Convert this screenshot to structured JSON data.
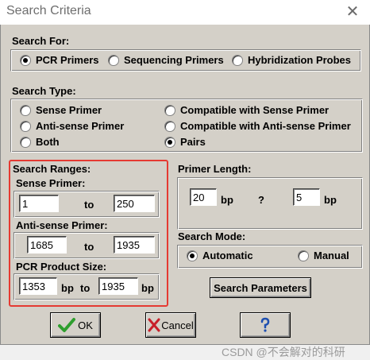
{
  "window": {
    "title": "Search Criteria",
    "close_glyph": "✕"
  },
  "search_for": {
    "label": "Search For:",
    "options": [
      {
        "label": "PCR Primers",
        "selected": true
      },
      {
        "label": "Sequencing Primers",
        "selected": false
      },
      {
        "label": "Hybridization Probes",
        "selected": false
      }
    ]
  },
  "search_type": {
    "label": "Search Type:",
    "options": [
      {
        "label": "Sense Primer",
        "selected": false
      },
      {
        "label": "Compatible with Sense Primer",
        "selected": false
      },
      {
        "label": "Anti-sense Primer",
        "selected": false
      },
      {
        "label": "Compatible with Anti-sense Primer",
        "selected": false
      },
      {
        "label": "Both",
        "selected": false
      },
      {
        "label": "Pairs",
        "selected": true
      }
    ]
  },
  "search_ranges": {
    "label": "Search Ranges:",
    "sense": {
      "label": "Sense Primer:",
      "from": "1",
      "to_label": "to",
      "to": "250"
    },
    "antisense": {
      "label": "Anti-sense Primer:",
      "from": "1685",
      "to_label": "to",
      "to": "1935"
    },
    "product": {
      "label": "PCR Product Size:",
      "from": "1353",
      "unit": "bp",
      "to_label": "to",
      "to": "1935",
      "unit2": "bp"
    }
  },
  "primer_length": {
    "label": "Primer Length:",
    "min": "20",
    "unit": "bp",
    "mid": "?",
    "max": "5",
    "unit2": "bp"
  },
  "search_mode": {
    "label": "Search Mode:",
    "options": [
      {
        "label": "Automatic",
        "selected": true
      },
      {
        "label": "Manual",
        "selected": false
      }
    ]
  },
  "buttons": {
    "params": "Search Parameters",
    "ok": "OK",
    "cancel": "Cancel"
  },
  "icons": {
    "ok": "check-icon",
    "cancel": "x-icon",
    "help": "help-icon"
  },
  "watermark": "CSDN @不会解对的科研",
  "colors": {
    "highlight_box": "#e53a32",
    "dialog_bg": "#d4d0c8",
    "check": "#2e9e2e",
    "cancel_x": "#c8202a"
  }
}
